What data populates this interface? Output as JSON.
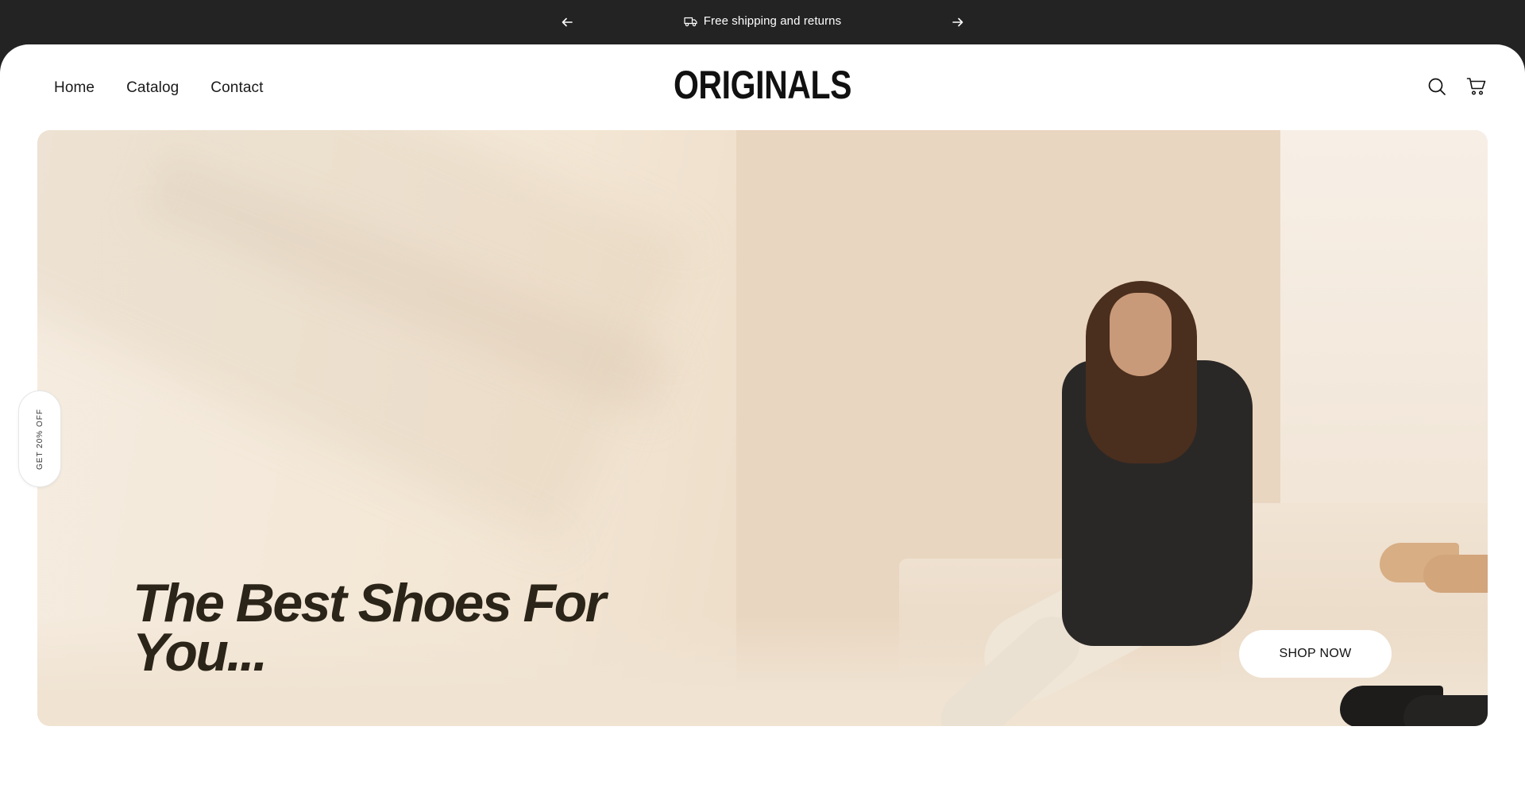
{
  "announcement": {
    "text": "Free shipping and returns",
    "icons": {
      "prev": "arrow-left-icon",
      "next": "arrow-right-icon",
      "truck": "truck-icon"
    }
  },
  "nav": {
    "items": [
      "Home",
      "Catalog",
      "Contact"
    ]
  },
  "brand": {
    "logo": "ORIGINALS"
  },
  "header_icons": [
    "search-icon",
    "cart-icon"
  ],
  "hero": {
    "title": "The Best Shoes For You...",
    "cta": "SHOP NOW"
  },
  "side_tab": {
    "label": "GET 20% OFF"
  },
  "colors": {
    "announcement_bg": "#232323",
    "hero_bg": "#f3e6d4",
    "title": "#2b2419"
  }
}
